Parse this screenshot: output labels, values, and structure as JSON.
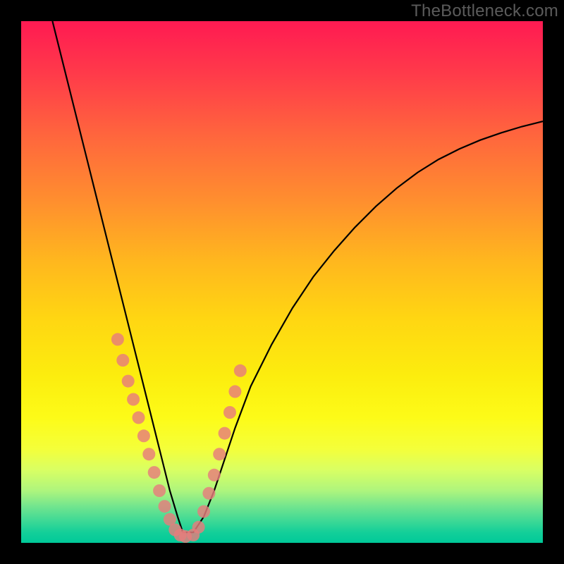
{
  "watermark": "TheBottleneck.com",
  "chart_data": {
    "type": "line",
    "title": "",
    "xlabel": "",
    "ylabel": "",
    "xlim": [
      0,
      100
    ],
    "ylim": [
      0,
      100
    ],
    "series": [
      {
        "name": "bottleneck-curve",
        "x": [
          6,
          8,
          10,
          12,
          14,
          16,
          18,
          20,
          22,
          24,
          25.5,
          27,
          28.5,
          30,
          31,
          33,
          35,
          37,
          39,
          41,
          44,
          48,
          52,
          56,
          60,
          64,
          68,
          72,
          76,
          80,
          84,
          88,
          92,
          96,
          100
        ],
        "y": [
          100,
          92,
          84,
          76,
          68,
          60,
          52,
          44,
          36,
          28,
          22,
          16,
          10,
          5,
          2,
          2,
          5,
          10,
          16,
          22,
          30,
          38,
          45,
          51,
          56,
          60.5,
          64.5,
          68,
          71,
          73.5,
          75.5,
          77.2,
          78.6,
          79.8,
          80.8
        ]
      }
    ],
    "markers": [
      {
        "series": "left-cluster",
        "x": [
          18.5,
          19.5,
          20.5,
          21.5,
          22.5,
          23.5,
          24.5,
          25.5,
          26.5,
          27.5,
          28.5,
          29.5,
          30.5,
          31.5
        ],
        "y": [
          39,
          35,
          31,
          27.5,
          24,
          20.5,
          17,
          13.5,
          10,
          7,
          4.5,
          2.5,
          1.5,
          1.2
        ]
      },
      {
        "series": "right-cluster",
        "x": [
          33.0,
          34.0,
          35.0,
          36.0,
          37.0,
          38.0,
          39.0,
          40.0,
          41.0,
          42.0
        ],
        "y": [
          1.5,
          3.0,
          6.0,
          9.5,
          13.0,
          17.0,
          21.0,
          25.0,
          29.0,
          33.0
        ]
      }
    ],
    "colors": {
      "curve": "#000000",
      "marker": "#e77d7d"
    }
  }
}
